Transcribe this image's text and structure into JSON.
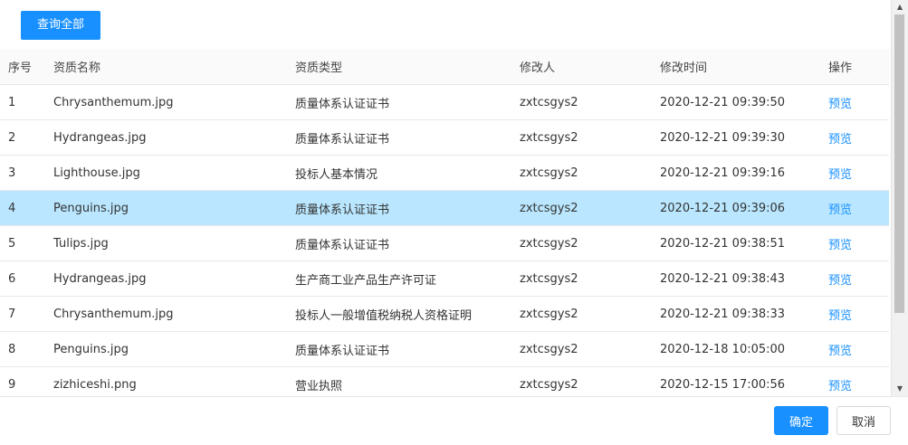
{
  "toolbar": {
    "query_all_label": "查询全部"
  },
  "table": {
    "headers": [
      "序号",
      "资质名称",
      "资质类型",
      "修改人",
      "修改时间",
      "操作"
    ],
    "rows": [
      {
        "index": "1",
        "name": "Chrysanthemum.jpg",
        "type": "质量体系认证证书",
        "modifier": "zxtcsgys2",
        "time": "2020-12-21 09:39:50",
        "action": "预览"
      },
      {
        "index": "2",
        "name": "Hydrangeas.jpg",
        "type": "质量体系认证证书",
        "modifier": "zxtcsgys2",
        "time": "2020-12-21 09:39:30",
        "action": "预览"
      },
      {
        "index": "3",
        "name": "Lighthouse.jpg",
        "type": "投标人基本情况",
        "modifier": "zxtcsgys2",
        "time": "2020-12-21 09:39:16",
        "action": "预览"
      },
      {
        "index": "4",
        "name": "Penguins.jpg",
        "type": "质量体系认证证书",
        "modifier": "zxtcsgys2",
        "time": "2020-12-21 09:39:06",
        "action": "预览"
      },
      {
        "index": "5",
        "name": "Tulips.jpg",
        "type": "质量体系认证证书",
        "modifier": "zxtcsgys2",
        "time": "2020-12-21 09:38:51",
        "action": "预览"
      },
      {
        "index": "6",
        "name": "Hydrangeas.jpg",
        "type": "生产商工业产品生产许可证",
        "modifier": "zxtcsgys2",
        "time": "2020-12-21 09:38:43",
        "action": "预览"
      },
      {
        "index": "7",
        "name": "Chrysanthemum.jpg",
        "type": "投标人一般增值税纳税人资格证明",
        "modifier": "zxtcsgys2",
        "time": "2020-12-21 09:38:33",
        "action": "预览"
      },
      {
        "index": "8",
        "name": "Penguins.jpg",
        "type": "质量体系认证证书",
        "modifier": "zxtcsgys2",
        "time": "2020-12-18 10:05:00",
        "action": "预览"
      },
      {
        "index": "9",
        "name": "zizhiceshi.png",
        "type": "营业执照",
        "modifier": "zxtcsgys2",
        "time": "2020-12-15 17:00:56",
        "action": "预览"
      }
    ],
    "selected_row": 4
  },
  "footer": {
    "ok_label": "确定",
    "cancel_label": "取消"
  },
  "colors": {
    "primary": "#1890ff",
    "selected_row": "#bae7ff",
    "header_bg": "#fafafa"
  }
}
